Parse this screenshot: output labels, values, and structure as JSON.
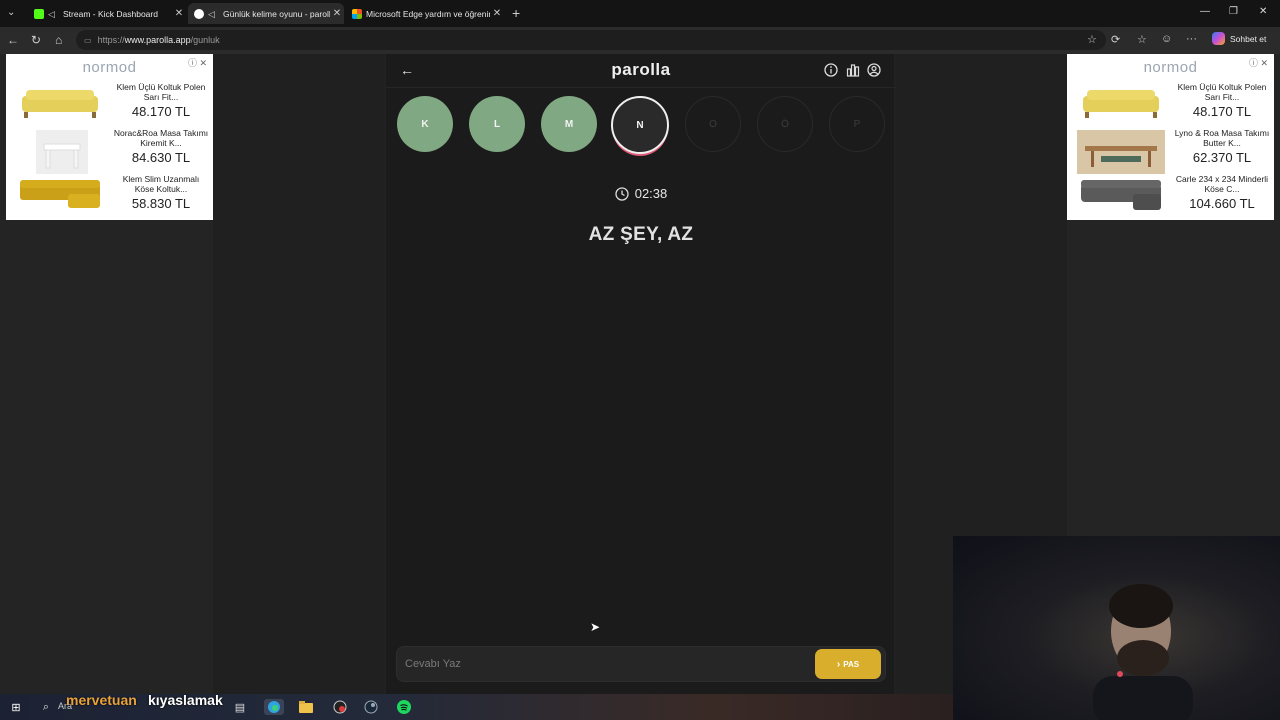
{
  "browser": {
    "tabs": [
      {
        "title": "Stream - Kick Dashboard",
        "active": false
      },
      {
        "title": "Günlük kelime oyunu - paroll",
        "active": true
      },
      {
        "title": "Microsoft Edge yardım ve öğrenim",
        "active": false
      }
    ],
    "url_prefix": "https://",
    "url_host": "www.parolla.app",
    "url_path": "/gunluk",
    "copilot_label": "Sohbet et"
  },
  "ads": {
    "brand": "normod",
    "left": [
      {
        "name": "Klem Üçlü Koltuk Polen Sarı Fit...",
        "price": "48.170 TL"
      },
      {
        "name": "Norac&Roa Masa Takımı Kiremit K...",
        "price": "84.630 TL"
      },
      {
        "name": "Klem Slim Uzanmalı Köse Koltuk...",
        "price": "58.830 TL"
      }
    ],
    "right": [
      {
        "name": "Klem Üçlü Koltuk Polen Sarı Fit...",
        "price": "48.170 TL"
      },
      {
        "name": "Lyno & Roa Masa Takımı Butter K...",
        "price": "62.370 TL"
      },
      {
        "name": "Carle 234 x 234 Minderli Köse C...",
        "price": "104.660 TL"
      }
    ]
  },
  "game": {
    "title": "parolla",
    "letters": [
      {
        "char": "K",
        "state": "done"
      },
      {
        "char": "L",
        "state": "done"
      },
      {
        "char": "M",
        "state": "done"
      },
      {
        "char": "N",
        "state": "current"
      },
      {
        "char": "O",
        "state": "todo"
      },
      {
        "char": "Ö",
        "state": "todo"
      },
      {
        "char": "P",
        "state": "todo"
      }
    ],
    "timer": "02:38",
    "clue": "AZ ŞEY, AZ",
    "answer_placeholder": "Cevabı Yaz",
    "pass_label": "PAS"
  },
  "taskbar": {
    "search_label": "Ara",
    "overlay_left": "mervetuan",
    "overlay_right": "kıyaslamak"
  },
  "colors": {
    "done": "#7fa883",
    "pass": "#d9ae2c",
    "current_ring": "#e05a7a"
  }
}
